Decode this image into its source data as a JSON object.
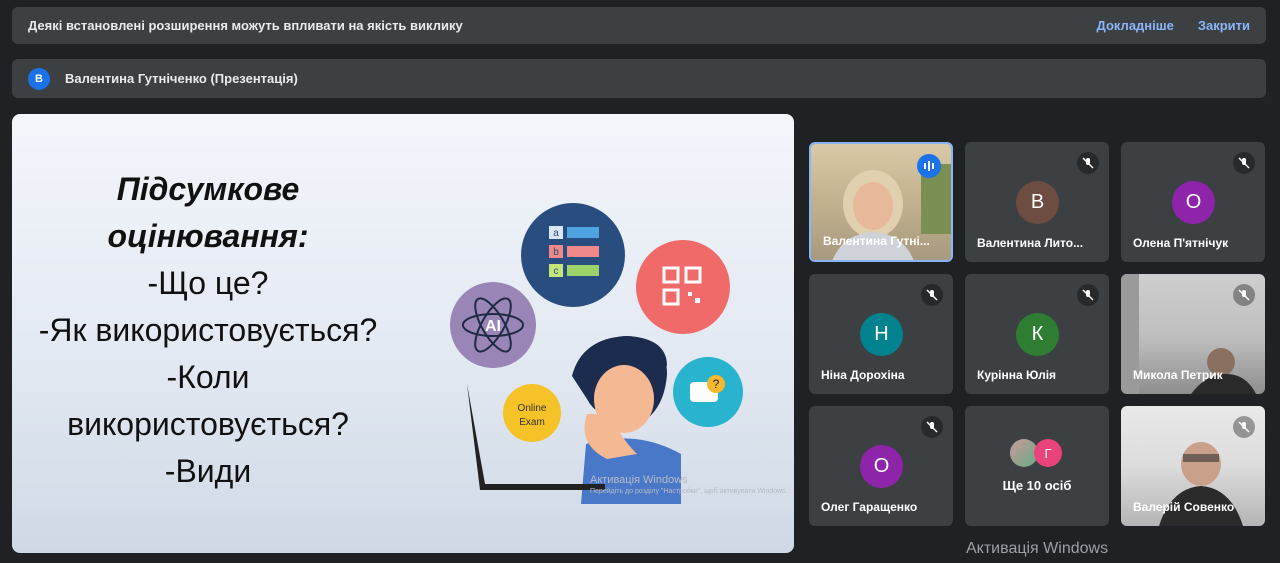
{
  "banner": {
    "message": "Деякі встановлені розширення можуть впливати на якість виклику",
    "learn_more": "Докладніше",
    "close": "Закрити"
  },
  "presenter": {
    "initial": "В",
    "name": "Валентина Гутніченко (Презентація)"
  },
  "slide": {
    "title_line1": "Підсумкове",
    "title_line2": "оцінювання:",
    "line1": "-Що це?",
    "line2": "-Як використовується?",
    "line3": "-Коли",
    "line4": "використовується?",
    "line5": "-Види",
    "ai_label": "AI",
    "online_exam_line1": "Online",
    "online_exam_line2": "Exam",
    "quiz_a": "a",
    "quiz_b": "b",
    "quiz_c": "c",
    "activation_title": "Активація Windows",
    "activation_sub": "Перейдіть до розділу \"Настройки\", щоб активувати Windows."
  },
  "participants": [
    {
      "name": "Валентина Гутні...",
      "initial": "",
      "color": "",
      "speaking": true
    },
    {
      "name": "Валентина Лито...",
      "initial": "В",
      "color": "#6d4c41",
      "speaking": false
    },
    {
      "name": "Олена П'ятнічук",
      "initial": "О",
      "color": "#8e24aa",
      "speaking": false
    },
    {
      "name": "Ніна Дорохіна",
      "initial": "Н",
      "color": "#00838f",
      "speaking": false
    },
    {
      "name": "Курінна Юлія",
      "initial": "К",
      "color": "#2e7d32",
      "speaking": false
    },
    {
      "name": "Микола Петрик",
      "initial": "",
      "color": "",
      "speaking": false
    },
    {
      "name": "Олег Гаращенко",
      "initial": "О",
      "color": "#8e24aa",
      "speaking": false
    },
    {
      "name": "Валерій Совенко",
      "initial": "",
      "color": "",
      "speaking": false
    }
  ],
  "more": {
    "initial": "Г",
    "label": "Ще 10 осіб"
  },
  "windows_watermark": "Активація Windows"
}
